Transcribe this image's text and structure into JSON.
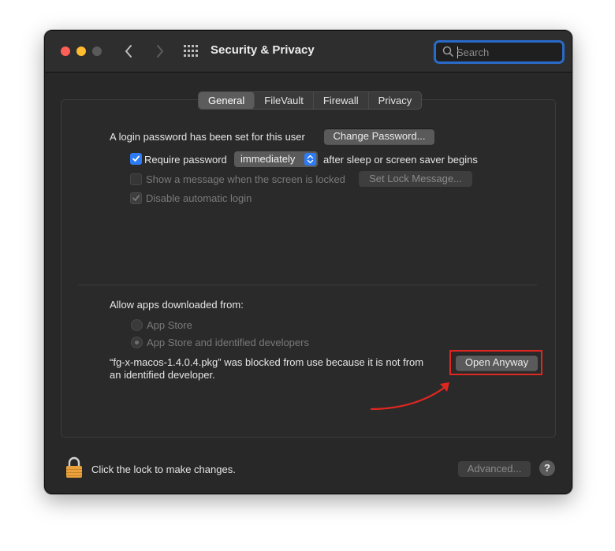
{
  "window": {
    "title": "Security & Privacy",
    "search": {
      "placeholder": "Search",
      "value": ""
    }
  },
  "tabs": [
    {
      "label": "General",
      "active": true
    },
    {
      "label": "FileVault",
      "active": false
    },
    {
      "label": "Firewall",
      "active": false
    },
    {
      "label": "Privacy",
      "active": false
    }
  ],
  "general": {
    "login_password_text": "A login password has been set for this user",
    "change_password_label": "Change Password...",
    "require_password": {
      "checked": true,
      "label": "Require password",
      "selected_option": "immediately",
      "suffix": "after sleep or screen saver begins"
    },
    "show_message": {
      "checked": false,
      "enabled": false,
      "label": "Show a message when the screen is locked",
      "button_label": "Set Lock Message..."
    },
    "disable_auto_login": {
      "checked": true,
      "enabled": false,
      "label": "Disable automatic login"
    }
  },
  "allow_apps": {
    "heading": "Allow apps downloaded from:",
    "options": [
      {
        "label": "App Store",
        "selected": false
      },
      {
        "label": "App Store and identified developers",
        "selected": true
      }
    ],
    "blocked_message_line1": "“fg-x-macos-1.4.0.4.pkg” was blocked from use because it is not from",
    "blocked_message_line2": "an identified developer.",
    "open_anyway_label": "Open Anyway"
  },
  "footer": {
    "lock_text": "Click the lock to make changes.",
    "advanced_label": "Advanced...",
    "help_label": "?"
  },
  "colors": {
    "accent_blue": "#2e7bf6",
    "highlight_red": "#e0271f",
    "lock_gold": "#e9a23b"
  }
}
